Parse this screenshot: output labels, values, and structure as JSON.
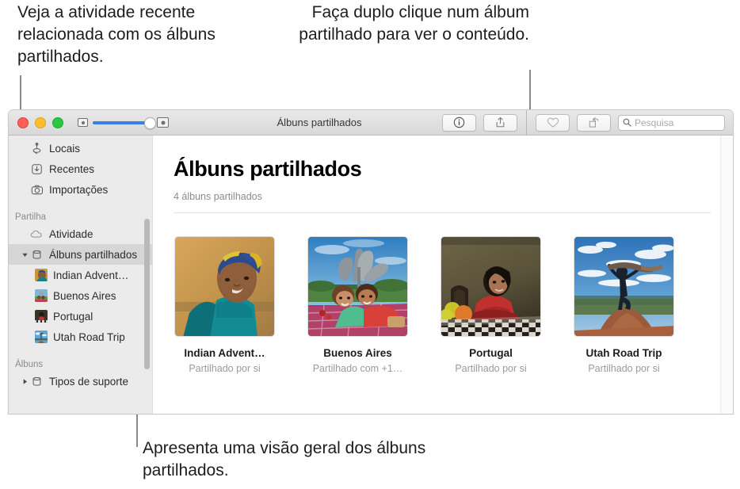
{
  "callouts": {
    "left": "Veja a atividade recente relacionada com os álbuns partilhados.",
    "top": "Faça duplo clique num álbum partilhado para ver o conteúdo.",
    "bottom": "Apresenta uma visão geral dos álbuns partilhados."
  },
  "window": {
    "title": "Álbuns partilhados",
    "traffic_lights": [
      "close-red",
      "minimize-yellow",
      "maximize-green"
    ],
    "zoom_slider": {
      "min_icon": "small-thumbnail-icon",
      "max_icon": "large-thumbnail-icon",
      "value": 92,
      "accent": "#3b7dea"
    },
    "toolbar": {
      "info_label": "info-circle-icon",
      "share_label": "share-icon",
      "favorite_label": "heart-icon",
      "rotate_label": "rotate-icon"
    },
    "search": {
      "placeholder": "Pesquisa",
      "value": "",
      "icon": "search-icon"
    }
  },
  "sidebar": {
    "items": [
      {
        "label": "Locais",
        "icon": "location-pin-icon",
        "type": "row"
      },
      {
        "label": "Recentes",
        "icon": "download-tray-icon",
        "type": "row"
      },
      {
        "label": "Importações",
        "icon": "camera-icon",
        "type": "row"
      }
    ],
    "section_share": {
      "header": "Partilha",
      "items": [
        {
          "label": "Atividade",
          "icon": "cloud-icon",
          "type": "row"
        },
        {
          "label": "Álbuns partilhados",
          "icon": "album-stack-icon",
          "type": "group",
          "expanded": true,
          "selected": true
        }
      ],
      "children": [
        {
          "label": "Indian Advent…",
          "thumb": "indian-adventure-thumb"
        },
        {
          "label": "Buenos Aires",
          "thumb": "buenos-aires-thumb"
        },
        {
          "label": "Portugal",
          "thumb": "portugal-thumb"
        },
        {
          "label": "Utah Road Trip",
          "thumb": "utah-road-trip-thumb"
        }
      ]
    },
    "section_albums": {
      "header": "Álbuns",
      "items": [
        {
          "label": "Tipos de suporte",
          "icon": "album-stack-icon",
          "type": "group",
          "expanded": false
        }
      ]
    }
  },
  "main": {
    "title": "Álbuns partilhados",
    "subtitle": "4 álbuns partilhados",
    "albums": [
      {
        "title": "Indian Advent…",
        "subtitle": "Partilhado por si",
        "thumb": "indian-adventure-thumb"
      },
      {
        "title": "Buenos Aires",
        "subtitle": "Partilhado com +1…",
        "thumb": "buenos-aires-thumb"
      },
      {
        "title": "Portugal",
        "subtitle": "Partilhado por si",
        "thumb": "portugal-thumb"
      },
      {
        "title": "Utah Road Trip",
        "subtitle": "Partilhado por si",
        "thumb": "utah-road-trip-thumb"
      }
    ]
  }
}
